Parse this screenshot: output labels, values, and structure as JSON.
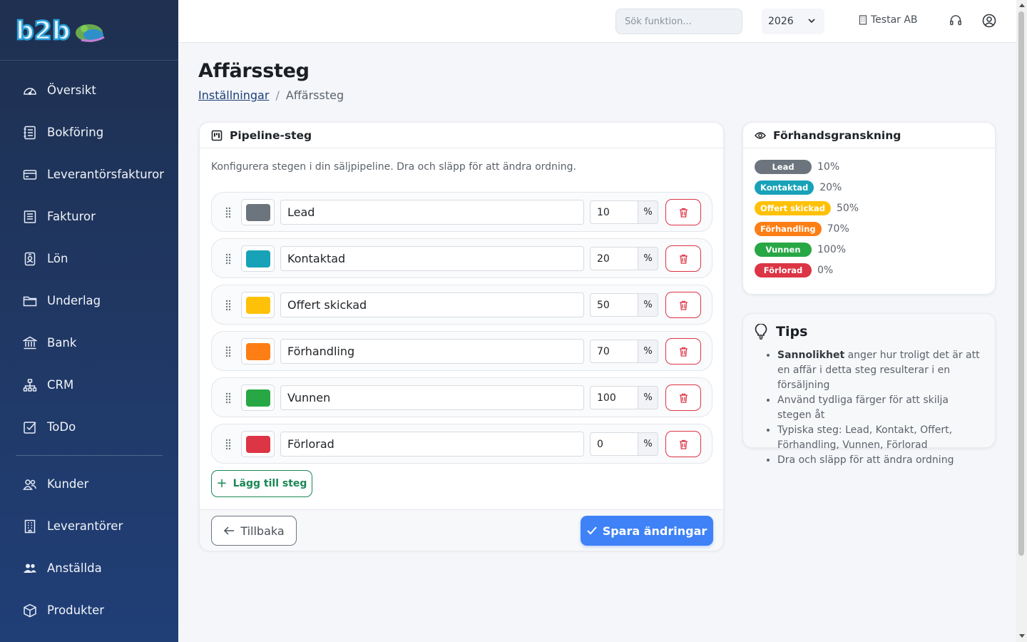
{
  "brand": {
    "logo_text": "b2b"
  },
  "sidebar": {
    "items": [
      {
        "label": "Översikt",
        "icon": "speedometer-icon"
      },
      {
        "label": "Bokföring",
        "icon": "journal-icon"
      },
      {
        "label": "Leverantörsfakturor",
        "icon": "credit-card-icon"
      },
      {
        "label": "Fakturor",
        "icon": "receipt-icon"
      },
      {
        "label": "Lön",
        "icon": "person-badge-icon"
      },
      {
        "label": "Underlag",
        "icon": "folder-icon"
      },
      {
        "label": "Bank",
        "icon": "bank-icon"
      },
      {
        "label": "CRM",
        "icon": "diagram-icon"
      },
      {
        "label": "ToDo",
        "icon": "check-square-icon"
      }
    ],
    "items_secondary": [
      {
        "label": "Kunder",
        "icon": "people-icon"
      },
      {
        "label": "Leverantörer",
        "icon": "building-icon"
      },
      {
        "label": "Anställda",
        "icon": "people-fill-icon"
      },
      {
        "label": "Produkter",
        "icon": "box-icon"
      }
    ]
  },
  "topbar": {
    "search_placeholder": "Sök funktion...",
    "year": "2026",
    "company": "Testar AB"
  },
  "page": {
    "title": "Affärssteg",
    "breadcrumb_link": "Inställningar",
    "breadcrumb_sep": "/",
    "breadcrumb_current": "Affärssteg"
  },
  "pipeline": {
    "title": "Pipeline-steg",
    "description": "Konfigurera stegen i din säljpipeline. Dra och släpp för att ändra ordning.",
    "percent_sign": "%",
    "stages": [
      {
        "name": "Lead",
        "probability": "10",
        "color": "#6c757d"
      },
      {
        "name": "Kontaktad",
        "probability": "20",
        "color": "#17a2b8"
      },
      {
        "name": "Offert skickad",
        "probability": "50",
        "color": "#ffc107"
      },
      {
        "name": "Förhandling",
        "probability": "70",
        "color": "#fd7e14"
      },
      {
        "name": "Vunnen",
        "probability": "100",
        "color": "#28a745"
      },
      {
        "name": "Förlorad",
        "probability": "0",
        "color": "#dc3545"
      }
    ],
    "add_label": "Lägg till steg",
    "back_label": "Tillbaka",
    "save_label": "Spara ändringar"
  },
  "preview": {
    "title": "Förhandsgranskning",
    "items": [
      {
        "label": "Lead",
        "pct": "10%",
        "color": "#6c757d"
      },
      {
        "label": "Kontaktad",
        "pct": "20%",
        "color": "#17a2b8"
      },
      {
        "label": "Offert skickad",
        "pct": "50%",
        "color": "#ffc107"
      },
      {
        "label": "Förhandling",
        "pct": "70%",
        "color": "#fd7e14"
      },
      {
        "label": "Vunnen",
        "pct": "100%",
        "color": "#28a745"
      },
      {
        "label": "Förlorad",
        "pct": "0%",
        "color": "#dc3545"
      }
    ]
  },
  "tips": {
    "title": "Tips",
    "items": [
      {
        "bold": "Sannolikhet",
        "text": " anger hur troligt det är att en affär i detta steg resulterar i en försäljning"
      },
      {
        "bold": "",
        "text": "Använd tydliga färger för att skilja stegen åt"
      },
      {
        "bold": "",
        "text": "Typiska steg: Lead, Kontakt, Offert, Förhandling, Vunnen, Förlorad"
      },
      {
        "bold": "",
        "text": "Dra och släpp för att ändra ordning"
      }
    ]
  }
}
